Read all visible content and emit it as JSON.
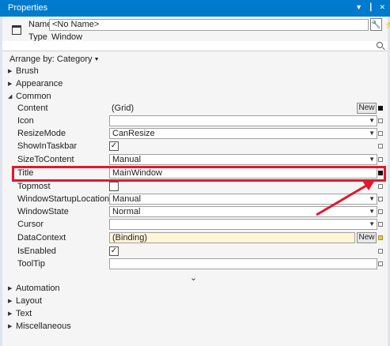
{
  "panel": {
    "title": "Properties"
  },
  "header": {
    "name_label": "Name",
    "name_value": "<No Name>",
    "type_label": "Type",
    "type_value": "Window"
  },
  "arrange": {
    "label": "Arrange by: Category"
  },
  "categories_top": [
    "Brush",
    "Appearance",
    "Common"
  ],
  "properties": [
    {
      "label": "Content",
      "value": "(Grid)",
      "button": "New"
    },
    {
      "label": "Icon",
      "value": ""
    },
    {
      "label": "ResizeMode",
      "value": "CanResize"
    },
    {
      "label": "ShowInTaskbar",
      "check": "✓"
    },
    {
      "label": "SizeToContent",
      "value": "Manual"
    },
    {
      "label": "Title",
      "value": "MainWindow"
    },
    {
      "label": "Topmost",
      "check": ""
    },
    {
      "label": "WindowStartupLocation",
      "value": "Manual"
    },
    {
      "label": "WindowState",
      "value": "Normal"
    },
    {
      "label": "Cursor",
      "value": ""
    },
    {
      "label": "DataContext",
      "value": "(Binding)",
      "button": "New"
    },
    {
      "label": "IsEnabled",
      "check": "✓"
    },
    {
      "label": "ToolTip",
      "value": ""
    }
  ],
  "categories_bottom": [
    "Automation",
    "Layout",
    "Text",
    "Miscellaneous"
  ],
  "colors": {
    "accent": "#007acc",
    "highlight": "#e0192c",
    "binding": "#e8c56a"
  }
}
